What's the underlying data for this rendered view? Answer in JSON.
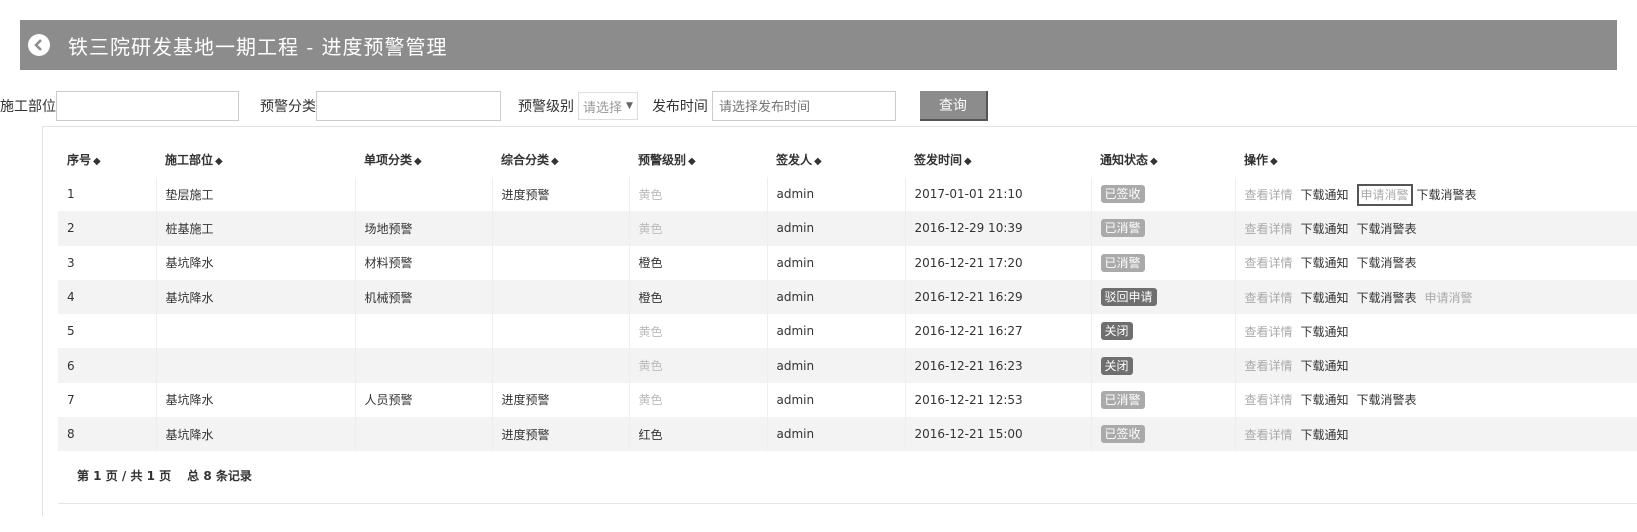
{
  "header": {
    "title": "铁三院研发基地一期工程 - 进度预警管理"
  },
  "filters": {
    "part_label": "施工部位",
    "part_value": "",
    "category_label": "预警分类",
    "category_value": "",
    "level_label": "预警级别",
    "level_value": "请选择",
    "time_label": "发布时间",
    "time_placeholder": "请选择发布时间",
    "query_label": "查询"
  },
  "table": {
    "columns": [
      "序号",
      "施工部位",
      "单项分类",
      "综合分类",
      "预警级别",
      "签发人",
      "签发时间",
      "通知状态",
      "操作"
    ],
    "sort_glyph": "◆",
    "rows": [
      {
        "no": "1",
        "part": "垫层施工",
        "item": "",
        "overall": "进度预警",
        "level": "黄色",
        "issuer": "admin",
        "time": "2017-01-01 21:10",
        "status": "已签收"
      },
      {
        "no": "2",
        "part": "桩基施工",
        "item": "场地预警",
        "overall": "",
        "level": "黄色",
        "issuer": "admin",
        "time": "2016-12-29 10:39",
        "status": "已消警"
      },
      {
        "no": "3",
        "part": "基坑降水",
        "item": "材料预警",
        "overall": "",
        "level": "橙色",
        "issuer": "admin",
        "time": "2016-12-21 17:20",
        "status": "已消警"
      },
      {
        "no": "4",
        "part": "基坑降水",
        "item": "机械预警",
        "overall": "",
        "level": "橙色",
        "issuer": "admin",
        "time": "2016-12-21 16:29",
        "status": "驳回申请"
      },
      {
        "no": "5",
        "part": "",
        "item": "",
        "overall": "",
        "level": "黄色",
        "issuer": "admin",
        "time": "2016-12-21 16:27",
        "status": "关闭"
      },
      {
        "no": "6",
        "part": "",
        "item": "",
        "overall": "",
        "level": "黄色",
        "issuer": "admin",
        "time": "2016-12-21 16:23",
        "status": "关闭"
      },
      {
        "no": "7",
        "part": "基坑降水",
        "item": "人员预警",
        "overall": "进度预警",
        "level": "黄色",
        "issuer": "admin",
        "time": "2016-12-21 12:53",
        "status": "已消警"
      },
      {
        "no": "8",
        "part": "基坑降水",
        "item": "",
        "overall": "进度预警",
        "level": "红色",
        "issuer": "admin",
        "time": "2016-12-21 15:00",
        "status": "已签收"
      }
    ],
    "actions": {
      "detail": "查看详情",
      "download_notice": "下载通知",
      "apply_clear": "申请消警",
      "download_clear_form": "下载消警表"
    }
  },
  "pager": {
    "page_info": "第 1 页 / 共 1 页",
    "total": "总 8 条记录"
  },
  "colors": {
    "header_bg": "#8c8c8c",
    "badge_light": "#aaaaaa",
    "badge_dark": "#6f6f6f",
    "row_alt": "#f3f3f3"
  }
}
